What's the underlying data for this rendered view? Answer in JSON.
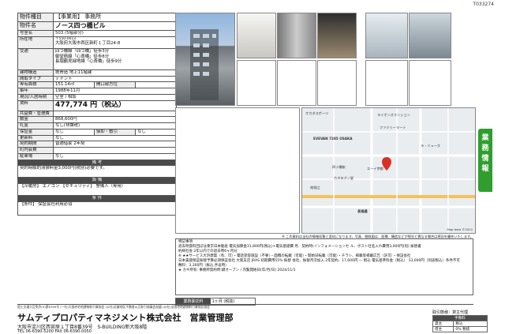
{
  "doc_id": "T033274",
  "spec": {
    "type_key": "物件種目",
    "type_val": "【事業用】 事務所",
    "name_key": "物件名",
    "name_val": "ノース四つ橋ビル",
    "room_key": "号室名",
    "room_val": "503 (5階部分)",
    "loc_key": "所在地",
    "loc_postal": "〒550-0013",
    "loc_val": "大阪府大阪市西区新町１丁目24-8",
    "traffic_key": "交通",
    "traffic_1": "四つ橋線「四つ橋」徒歩3分",
    "traffic_2": "御堂筋線「心斎橋」徒歩8分",
    "traffic_3": "長堀鶴見緑地線「心斎橋」徒歩9分",
    "struct_key": "建物構造",
    "struct_val": "鉄骨造 地上11階建",
    "layout_key": "間取タイプ",
    "layout_val": "テナント",
    "area_key": "専有面積",
    "area_val": "151.14㎡",
    "direction_key": "開口部方位",
    "built_key": "築年",
    "built_val": "1988年11月",
    "status_key": "現況/入居時期",
    "status_val": "空室 / 相談",
    "rent_key": "賃料",
    "rent_val": "477,774 円（税込）",
    "mgmt_key": "共益費・管理費",
    "deposit_key": "敷金",
    "deposit_val": "868,600円",
    "key_money_key": "礼金",
    "key_money_val": "なし(非課税)",
    "guarantee_key": "保証金",
    "guarantee_val": "なし",
    "deduct_key": "償却・敷引",
    "deduct_val": "なし",
    "renewal_key": "更新料",
    "renewal_val": "なし",
    "contract_key": "契約期間",
    "contract_val": "普通借家 2年契",
    "town_key": "町内会費",
    "parking_key": "駐車場",
    "parking_val": "なし"
  },
  "sections": {
    "remarks_head": "備 考",
    "remarks_text": "契約時解約清掃料金3,000円(税別)必要です。",
    "equip_head": "設 備",
    "equip_text": "【冷暖房】 エアコン 【セキュリティ】 警備人（専用）",
    "cond_head": "条 件",
    "cond_text": "【条件】 保証会社利用必須"
  },
  "map": {
    "labels": [
      "オカダスポーツ",
      "ライオンズマンション",
      "ファミリーマート",
      "EVEVAN 7285 OSAKA",
      "四ツ橋駅",
      "南堀江",
      "長堀通",
      "カタログノ星",
      "ラ・ミューズ",
      "エーイ京都",
      "Map data ©2022"
    ]
  },
  "notes_line": "※ この資料は当社の情報収集と変化になります。写真、間取図は、面積、構造などが現況と異なる場合は現況を優先いたします。",
  "remarks_box": {
    "title": "特記事項",
    "lines": [
      "退去時貸料回ぼは東京日本動産 電気加算金31,800円(税込)+電気基礎費 月、契約時(インフォメーションセ ル、ボスト社名入れ費用3,000円(別) 振替書",
      "約締社会 2年以内での退去時6ヶ月分",
      "※ ★★サービス大浜建築（有、可）・電話受容施設（不要）・面積の転載（可能）・開始日転載（可能）・チラシ、掲載等掲載広告（許可）・保証会社",
      "日本賃貸保証振替予算必須保証会社 大阪支店 JRAS 初期費用55% 振替 会社、振替月次加入 2年契約、17,600円 ― 税込 電気基準料金（税込） 33,000円（別途税込）条件不可",
      "敷料：3,300円（振込,手返時）",
      "★ カギ所有: 事務所契約時:鍵オープン / 内覧開始日(年/月/日) 2024/11/1"
    ]
  },
  "flat_rate": {
    "label": "業務委託料",
    "value": "1ヶ月 (税抜)"
  },
  "side_tab": [
    "業",
    "務",
    "情",
    "報"
  ],
  "footer": {
    "license": "国土交通大臣免許(3)第8399号 (一社)大阪府宅地建物取引業協会 (公社)近畿地区不動産公正取引協議会加盟 (公社)全国宅地建物取引業保証協会",
    "company": "サムティプロパティマネジメント株式会社　営業管理部",
    "address": "大阪市淀川区西宮原１丁目8番39号　S-BUILDING新大阪8階",
    "tel": "TEL 06-6390-5200  FAX 06-6390-0050"
  },
  "fee_box": {
    "title": "取引態様：貸主代理",
    "head": "手数料",
    "row1_k": "貸主",
    "row1_v": "税込",
    "row2_k": "借主",
    "row2_v": "0% 税抜"
  },
  "colors": {
    "accent_green": "#2f9e2f",
    "header_gray": "#4b4b4b"
  }
}
